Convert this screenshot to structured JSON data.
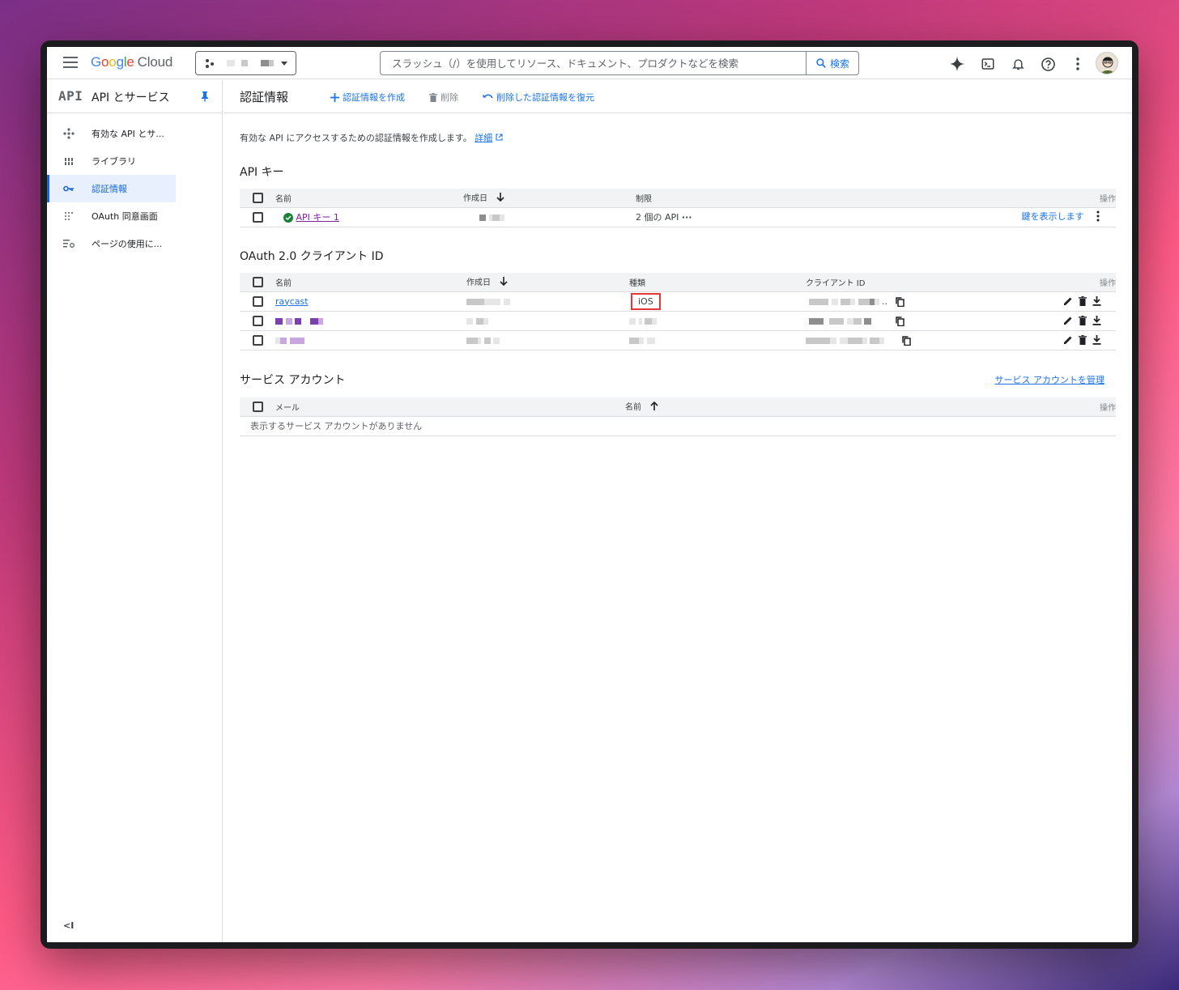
{
  "topbar": {
    "logo_google": "Google",
    "logo_cloud": "Cloud",
    "search_placeholder": "スラッシュ（/）を使用してリソース、ドキュメント、プロダクトなどを検索",
    "search_button": "検索"
  },
  "sidebar": {
    "logo": "API",
    "title": "API とサービス",
    "items": [
      {
        "label": "有効な API とサ...",
        "icon": "api-diamond-icon",
        "active": false
      },
      {
        "label": "ライブラリ",
        "icon": "library-icon",
        "active": false
      },
      {
        "label": "認証情報",
        "icon": "key-icon",
        "active": true
      },
      {
        "label": "OAuth 同意画面",
        "icon": "consent-dots-icon",
        "active": false
      },
      {
        "label": "ページの使用に...",
        "icon": "page-usage-icon",
        "active": false
      }
    ],
    "collapse": "<I"
  },
  "main": {
    "title": "認証情報",
    "actions": {
      "create": "認証情報を作成",
      "delete": "削除",
      "restore": "削除した認証情報を復元"
    },
    "intro": "有効な API にアクセスするための認証情報を作成します。",
    "intro_link": "詳細",
    "api_keys": {
      "title": "API キー",
      "headers": {
        "name": "名前",
        "created": "作成日",
        "restriction": "制限",
        "ops": "操作"
      },
      "rows": [
        {
          "name": "API キー 1",
          "restriction": "2 個の API",
          "show_key": "鍵を表示します"
        }
      ]
    },
    "oauth": {
      "title": "OAuth 2.0 クライアント ID",
      "headers": {
        "name": "名前",
        "created": "作成日",
        "type": "種類",
        "client_id": "クライアント ID",
        "ops": "操作"
      },
      "rows": [
        {
          "name": "raycast",
          "type": "iOS"
        },
        {
          "name": "",
          "type": ""
        },
        {
          "name": "",
          "type": ""
        }
      ]
    },
    "service_accounts": {
      "title": "サービス アカウント",
      "manage_link": "サービス アカウントを管理",
      "headers": {
        "email": "メール",
        "name": "名前",
        "ops": "操作"
      },
      "empty": "表示するサービス アカウントがありません"
    }
  },
  "colors": {
    "accent": "#1a73e8",
    "link_visited": "#7b1fa2",
    "highlight_box": "#e53935",
    "active_nav_bg": "#e8f0fe"
  }
}
